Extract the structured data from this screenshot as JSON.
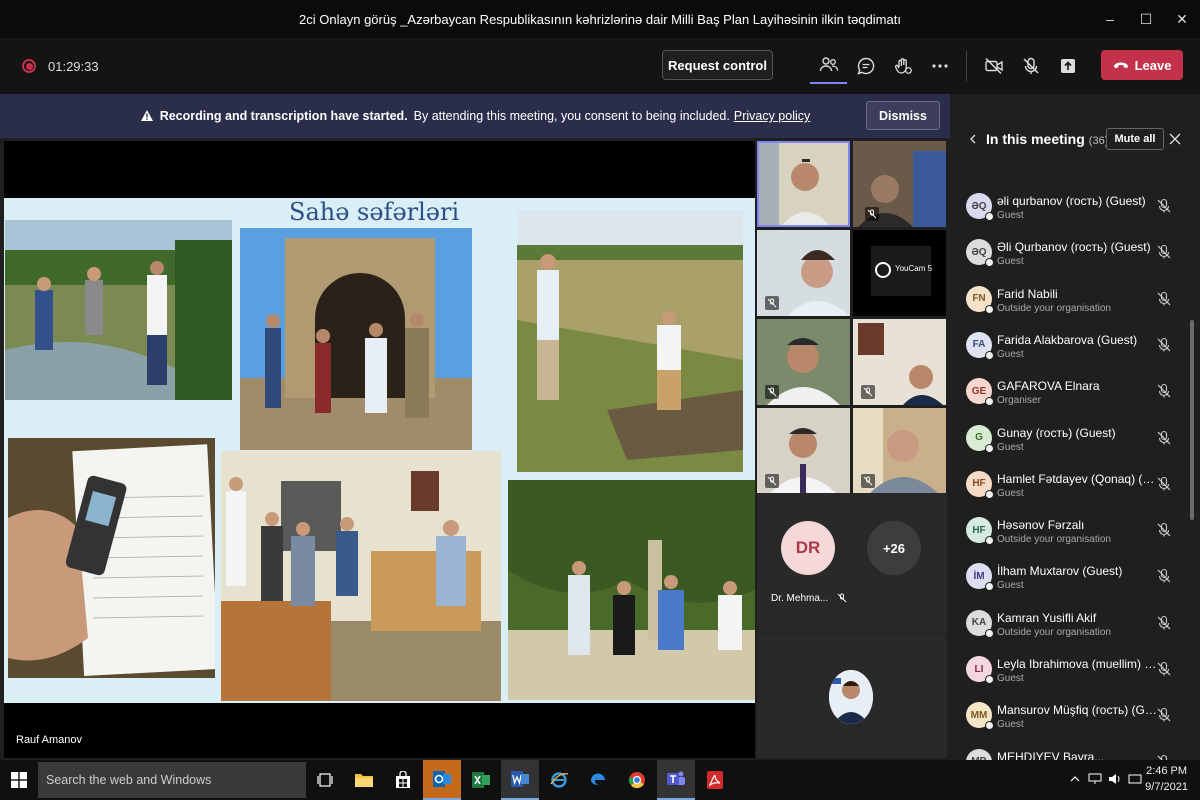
{
  "window": {
    "title": "2ci Onlayn görüş _Azərbaycan Respublikasının kəhrizlərinə dair Milli Baş Plan Layihəsinin ilkin təqdimatı",
    "controls": [
      "–",
      "☐",
      "✕"
    ]
  },
  "toolbar": {
    "timer": "01:29:33",
    "request_control": "Request control",
    "leave": "Leave"
  },
  "banner": {
    "strong": "Recording and transcription have started.",
    "text": "By attending this meeting, you consent to being included.",
    "link": "Privacy policy",
    "dismiss": "Dismiss"
  },
  "slide": {
    "title": "Sahə səfərləri",
    "speaker": "Rauf Amanov"
  },
  "grid": {
    "youcam_label": "YouCam 5",
    "dr_initials": "DR",
    "dr_name": "Dr. Mehma...",
    "more_count": "+26"
  },
  "panel": {
    "title": "In this meeting",
    "count": "(36)",
    "mute_all": "Mute all",
    "participants": [
      {
        "initials": "ƏQ",
        "name": "əli qurbanov (гость) (Guest)",
        "role": "Guest",
        "color": "#d9d9f0",
        "text": "#444"
      },
      {
        "initials": "ƏQ",
        "name": "Əli Qurbanov (гость) (Guest)",
        "role": "Guest",
        "color": "#dcdcdc",
        "text": "#444"
      },
      {
        "initials": "FN",
        "name": "Farid Nabili",
        "role": "Outside your organisation",
        "color": "#f5e2c8",
        "text": "#7a5a2a"
      },
      {
        "initials": "FA",
        "name": "Farida Alakbarova (Guest)",
        "role": "Guest",
        "color": "#dfe3f1",
        "text": "#3a4a7a"
      },
      {
        "initials": "GE",
        "name": "GAFAROVA Elnara",
        "role": "Organiser",
        "color": "#f6d6cf",
        "text": "#8a3a2a"
      },
      {
        "initials": "G",
        "name": "Gunay (гость) (Guest)",
        "role": "Guest",
        "color": "#d8ecd2",
        "text": "#3a6a2a"
      },
      {
        "initials": "HF",
        "name": "Hamlet Fətdayev (Qonaq) (Gu...",
        "role": "Guest",
        "color": "#f6dcc8",
        "text": "#8a4a1a"
      },
      {
        "initials": "HF",
        "name": "Həsənov Fərzalı",
        "role": "Outside your organisation",
        "color": "#d5eae0",
        "text": "#2a6a4a"
      },
      {
        "initials": "İM",
        "name": "İlham Muxtarov (Guest)",
        "role": "Guest",
        "color": "#dcdff2",
        "text": "#3a3a7a"
      },
      {
        "initials": "KA",
        "name": "Kamran Yusifli Akif",
        "role": "Outside your organisation",
        "color": "#dcdcdc",
        "text": "#444"
      },
      {
        "initials": "LI",
        "name": "Leyla Ibrahimova (muellim) (G...",
        "role": "Guest",
        "color": "#f3d6e0",
        "text": "#8a2a4a"
      },
      {
        "initials": "MM",
        "name": "Mansurov Müşfiq (гость) (Gu...",
        "role": "Guest",
        "color": "#f6e6c8",
        "text": "#7a5a1a"
      },
      {
        "initials": "MB",
        "name": "MEHDIYEV Bayra...",
        "role": "",
        "color": "#dcdcdc",
        "text": "#444"
      }
    ]
  },
  "taskbar": {
    "search_placeholder": "Search the web and Windows",
    "time": "2:46 PM",
    "date": "9/7/2021"
  },
  "colors": {
    "leave": "#c4314b",
    "banner": "#2b2e4a",
    "slide_bg": "#d9eef5",
    "slide_title": "#2d4f88"
  }
}
